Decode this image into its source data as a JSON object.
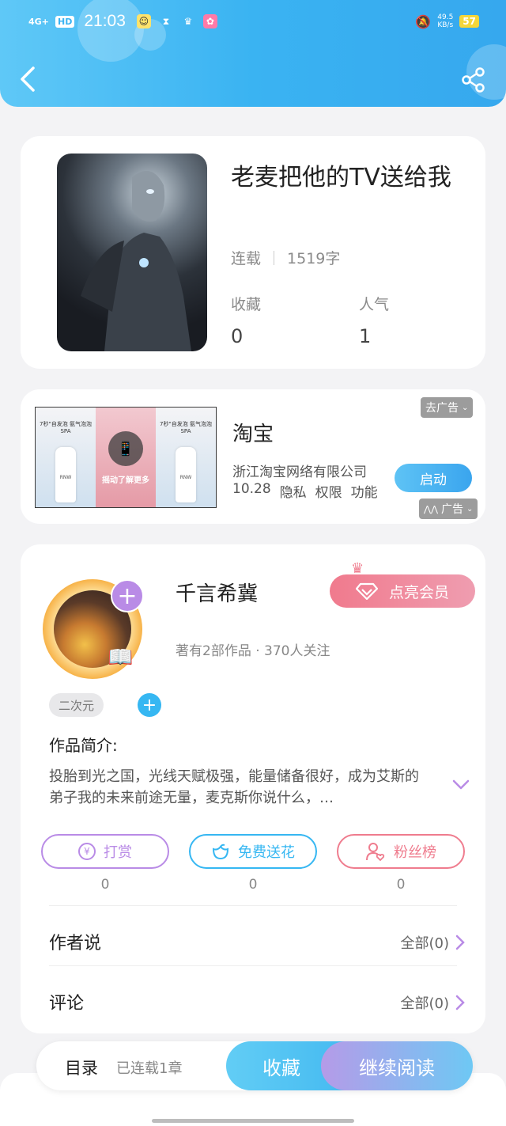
{
  "status_bar": {
    "network": "4G+",
    "hd": "HD",
    "time": "21:03",
    "speed": "49.5",
    "speed_unit": "KB/s",
    "battery": "57"
  },
  "header": {
    "back_icon": "chevron-left-icon",
    "share_icon": "share-icon"
  },
  "book": {
    "title": "老麦把他的TV送给我",
    "status": "连载",
    "word_count": "1519字",
    "favorites_label": "收藏",
    "favorites_value": "0",
    "popularity_label": "人气",
    "popularity_value": "1"
  },
  "ad": {
    "panel_left_text": "7秒\"自发泡 氨气泡泡SPA",
    "panel_right_text": "7秒\"自发泡 氨气泡泡SPA",
    "shake_text": "摇动了解更多",
    "bottle_label": "RNW",
    "name": "淘宝",
    "company": "浙江淘宝网络有限公司",
    "version": "10.28",
    "privacy": "隐私",
    "permissions": "权限",
    "features": "功能",
    "launch": "启动",
    "remove_ad": "去广告",
    "ad_tag": "广告"
  },
  "author": {
    "name": "千言希冀",
    "stats": "著有2部作品 · 370人关注",
    "vip_button": "点亮会员",
    "tag": "二次元",
    "intro_heading": "作品简介:",
    "intro_text": "投胎到光之国，光线天赋极强，能量储备很好，成为艾斯的弟子我的未来前途无量，麦克斯你说什么，…",
    "actions": [
      {
        "label": "打赏",
        "count": "0",
        "color": "#b98be6",
        "icon": "yen-icon"
      },
      {
        "label": "免费送花",
        "count": "0",
        "color": "#36b7f2",
        "icon": "flower-icon"
      },
      {
        "label": "粉丝榜",
        "count": "0",
        "color": "#ef7c8e",
        "icon": "user-heart-icon"
      }
    ],
    "author_says_label": "作者说",
    "author_says_all": "全部(0)",
    "comments_label": "评论",
    "comments_all": "全部(0)"
  },
  "bottom": {
    "toc": "目录",
    "toc_status": "已连载1章",
    "favorite": "收藏",
    "continue": "继续阅读"
  }
}
